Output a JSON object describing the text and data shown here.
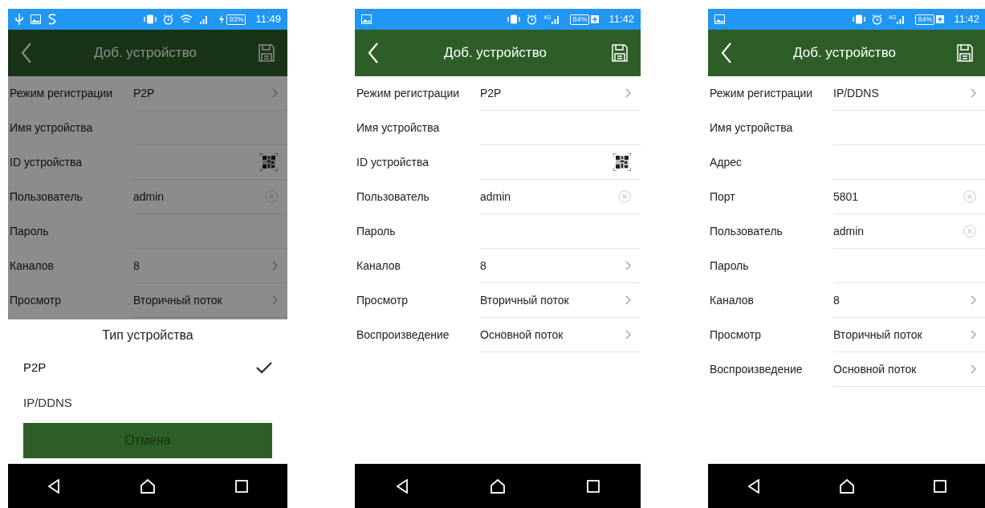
{
  "phones": [
    {
      "status_bar": {
        "left_icons": [
          {
            "kind": "usb"
          },
          {
            "kind": "image"
          },
          {
            "kind": "s-logo"
          }
        ],
        "right_icons": [
          {
            "kind": "vibrate"
          },
          {
            "kind": "alarm"
          },
          {
            "kind": "wifi"
          },
          {
            "kind": "signal"
          }
        ],
        "battery": {
          "text": "93%",
          "kind": "bolt"
        },
        "time": "11:49"
      },
      "header": {
        "title": "Доб. устройство"
      },
      "rows": [
        {
          "label": "Режим регистрации",
          "value": "P2P",
          "kind": "select"
        },
        {
          "label": "Имя устройства",
          "kind": "text"
        },
        {
          "label": "ID устройства",
          "kind": "qr"
        },
        {
          "label": "Пользователь",
          "value": "admin",
          "kind": "clear"
        },
        {
          "label": "Пароль",
          "kind": "text"
        },
        {
          "label": "Каналов",
          "value": "8",
          "kind": "select"
        },
        {
          "label": "Просмотр",
          "value": "Вторичный поток",
          "kind": "select"
        }
      ],
      "sheet": {
        "title": "Тип устройства",
        "options": [
          {
            "label": "P2P",
            "selected": true
          },
          {
            "label": "IP/DDNS",
            "selected": false
          }
        ],
        "cancel": "Отмена"
      }
    },
    {
      "status_bar": {
        "left_icons": [
          {
            "kind": "image"
          }
        ],
        "right_icons": [
          {
            "kind": "vibrate"
          },
          {
            "kind": "alarm"
          },
          {
            "kind": "signal",
            "label": "4G"
          }
        ],
        "battery": {
          "text": "84%",
          "kind": "plus"
        },
        "time": "11:42"
      },
      "header": {
        "title": "Доб. устройство"
      },
      "rows": [
        {
          "label": "Режим регистрации",
          "value": "P2P",
          "kind": "select"
        },
        {
          "label": "Имя устройства",
          "kind": "text"
        },
        {
          "label": "ID устройства",
          "kind": "qr"
        },
        {
          "label": "Пользователь",
          "value": "admin",
          "kind": "clear"
        },
        {
          "label": "Пароль",
          "kind": "text"
        },
        {
          "label": "Каналов",
          "value": "8",
          "kind": "select"
        },
        {
          "label": "Просмотр",
          "value": "Вторичный поток",
          "kind": "select"
        },
        {
          "label": "Воспроизведение",
          "value": "Основной поток",
          "kind": "select"
        }
      ]
    },
    {
      "status_bar": {
        "left_icons": [
          {
            "kind": "image"
          }
        ],
        "right_icons": [
          {
            "kind": "vibrate"
          },
          {
            "kind": "alarm"
          },
          {
            "kind": "signal",
            "label": "4G"
          }
        ],
        "battery": {
          "text": "84%",
          "kind": "plus"
        },
        "time": "11:42"
      },
      "header": {
        "title": "Доб. устройство"
      },
      "rows": [
        {
          "label": "Режим регистрации",
          "value": "IP/DDNS",
          "kind": "select"
        },
        {
          "label": "Имя устройства",
          "kind": "text"
        },
        {
          "label": "Адрес",
          "kind": "text"
        },
        {
          "label": "Порт",
          "value": "5801",
          "kind": "clear"
        },
        {
          "label": "Пользователь",
          "value": "admin",
          "kind": "clear"
        },
        {
          "label": "Пароль",
          "kind": "text"
        },
        {
          "label": "Каналов",
          "value": "8",
          "kind": "select"
        },
        {
          "label": "Просмотр",
          "value": "Вторичный поток",
          "kind": "select"
        },
        {
          "label": "Воспроизведение",
          "value": "Основной поток",
          "kind": "select"
        }
      ]
    }
  ]
}
